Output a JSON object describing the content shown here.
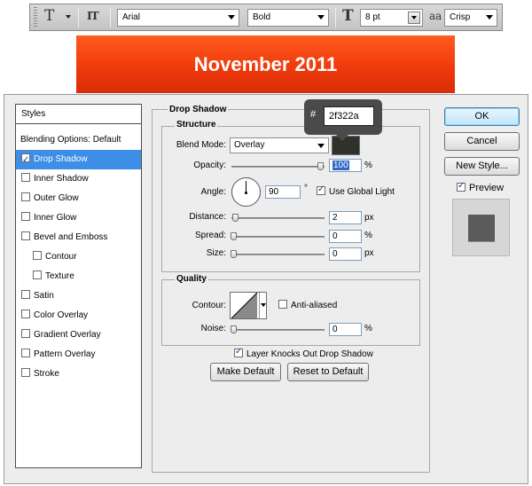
{
  "toolbar": {
    "tool_icon": "T",
    "orient_icon": "IT",
    "font_family": "Arial",
    "font_style": "Bold",
    "size_icon": "T",
    "font_size": "8 pt",
    "aa_icon": "aa",
    "antialias": "Crisp"
  },
  "banner": {
    "text": "November 2011",
    "color": "#f03a0c"
  },
  "color_tooltip": {
    "hash": "#",
    "value": "2f322a",
    "swatch_color": "#2f322a"
  },
  "styles_panel": {
    "header": "Styles",
    "blending": "Blending Options: Default",
    "items": [
      {
        "label": "Drop Shadow",
        "checked": true,
        "selected": true
      },
      {
        "label": "Inner Shadow",
        "checked": false
      },
      {
        "label": "Outer Glow",
        "checked": false
      },
      {
        "label": "Inner Glow",
        "checked": false
      },
      {
        "label": "Bevel and Emboss",
        "checked": false
      },
      {
        "label": "Contour",
        "checked": false
      },
      {
        "label": "Texture",
        "checked": false
      },
      {
        "label": "Satin",
        "checked": false
      },
      {
        "label": "Color Overlay",
        "checked": false
      },
      {
        "label": "Gradient Overlay",
        "checked": false
      },
      {
        "label": "Pattern Overlay",
        "checked": false
      },
      {
        "label": "Stroke",
        "checked": false
      }
    ]
  },
  "drop_shadow": {
    "title": "Drop Shadow",
    "structure_title": "Structure",
    "blend_mode_label": "Blend Mode:",
    "blend_mode": "Overlay",
    "opacity_label": "Opacity:",
    "opacity": "100",
    "opacity_unit": "%",
    "opacity_level": 1.0,
    "angle_label": "Angle:",
    "angle": "90",
    "angle_unit": "°",
    "global_light_label": "Use Global Light",
    "global_light_checked": true,
    "distance_label": "Distance:",
    "distance": "2",
    "distance_unit": "px",
    "spread_label": "Spread:",
    "spread": "0",
    "spread_unit": "%",
    "size_label": "Size:",
    "size": "0",
    "size_unit": "px",
    "quality_title": "Quality",
    "contour_label": "Contour:",
    "anti_aliased_label": "Anti-aliased",
    "noise_label": "Noise:",
    "noise": "0",
    "noise_unit": "%",
    "knockout_label": "Layer Knocks Out Drop Shadow",
    "knockout_checked": true,
    "make_default": "Make Default",
    "reset_default": "Reset to Default"
  },
  "side_buttons": {
    "ok": "OK",
    "cancel": "Cancel",
    "new_style": "New Style...",
    "preview_label": "Preview",
    "preview_checked": true
  }
}
